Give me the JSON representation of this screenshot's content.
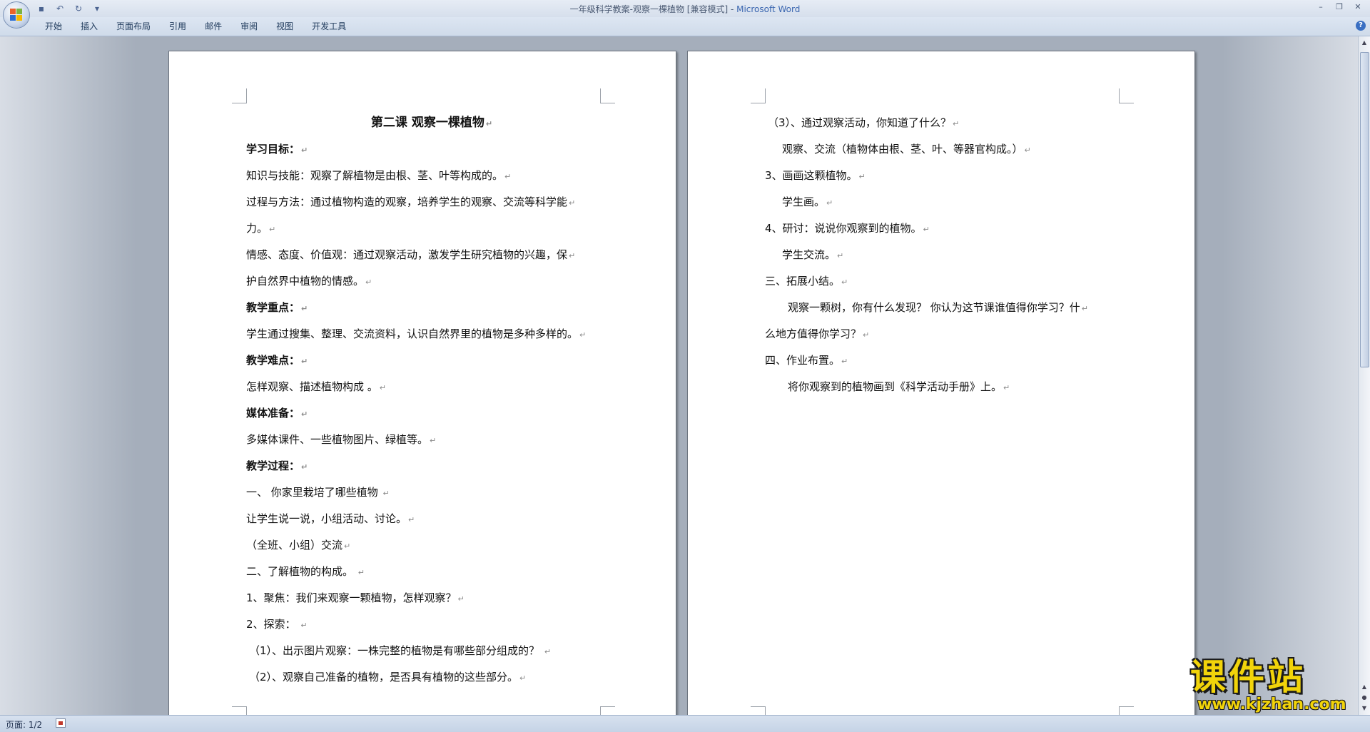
{
  "window": {
    "title_doc": "一年级科学教案-观察一棵植物 [兼容模式] - ",
    "title_app": "Microsoft Word",
    "minimize": "–",
    "restore": "❐",
    "close": "✕"
  },
  "quick_access": {
    "save": "▪",
    "undo": "↶",
    "redo": "↻",
    "customize": "▾"
  },
  "ribbon": {
    "tabs": [
      "开始",
      "插入",
      "页面布局",
      "引用",
      "邮件",
      "审阅",
      "视图",
      "开发工具"
    ],
    "help": "?"
  },
  "pages": {
    "left": [
      {
        "text": "第二课  观察一棵植物",
        "style": "title"
      },
      {
        "text": "学习目标：",
        "style": "bold"
      },
      {
        "text": "知识与技能：观察了解植物是由根、茎、叶等构成的。",
        "style": ""
      },
      {
        "text": "过程与方法：通过植物构造的观察，培养学生的观察、交流等科学能",
        "style": ""
      },
      {
        "text": "力。",
        "style": ""
      },
      {
        "text": "情感、态度、价值观：通过观察活动，激发学生研究植物的兴趣，保",
        "style": ""
      },
      {
        "text": "护自然界中植物的情感。",
        "style": ""
      },
      {
        "text": "教学重点：",
        "style": "bold"
      },
      {
        "text": "学生通过搜集、整理、交流资料，认识自然界里的植物是多种多样的。",
        "style": ""
      },
      {
        "text": "教学难点：",
        "style": "bold"
      },
      {
        "text": "怎样观察、描述植物构成 。",
        "style": ""
      },
      {
        "text": "媒体准备：",
        "style": "bold"
      },
      {
        "text": "多媒体课件、一些植物图片、绿植等。",
        "style": ""
      },
      {
        "text": "教学过程：",
        "style": "bold"
      },
      {
        "text": "一、  你家里栽培了哪些植物  ",
        "style": ""
      },
      {
        "text": "让学生说一说，小组活动、讨论。",
        "style": ""
      },
      {
        "text": "（全班、小组）交流",
        "style": ""
      },
      {
        "text": "二、了解植物的构成。  ",
        "style": ""
      },
      {
        "text": "1、聚焦：我们来观察一颗植物，怎样观察？",
        "style": ""
      },
      {
        "text": "2、探索：  ",
        "style": ""
      },
      {
        "text": "（1）、出示图片观察：一株完整的植物是有哪些部分组成的？  ",
        "style": "lead"
      },
      {
        "text": "（2）、观察自己准备的植物，是否具有植物的这些部分。",
        "style": "lead"
      }
    ],
    "right": [
      {
        "text": "（3）、通过观察活动，你知道了什么？",
        "style": "lead"
      },
      {
        "text": "观察、交流（植物体由根、茎、叶、等器官构成。）",
        "style": "indent1"
      },
      {
        "text": "3、画画这颗植物。",
        "style": ""
      },
      {
        "text": "学生画。",
        "style": "indent1"
      },
      {
        "text": "4、研讨：说说你观察到的植物。",
        "style": ""
      },
      {
        "text": "学生交流。",
        "style": "indent1"
      },
      {
        "text": "三、拓展小结。",
        "style": ""
      },
      {
        "text": "观察一颗树，你有什么发现？ 你认为这节课谁值得你学习？什",
        "style": "indent2"
      },
      {
        "text": "么地方值得你学习？",
        "style": ""
      },
      {
        "text": "四、作业布置。",
        "style": ""
      },
      {
        "text": "将你观察到的植物画到《科学活动手册》上。",
        "style": "indent2"
      }
    ]
  },
  "paragraph_mark": "↵",
  "statusbar": {
    "page": "页面: 1/2"
  },
  "watermark": {
    "main": "课件站",
    "url": "www.kjzhan.com"
  }
}
